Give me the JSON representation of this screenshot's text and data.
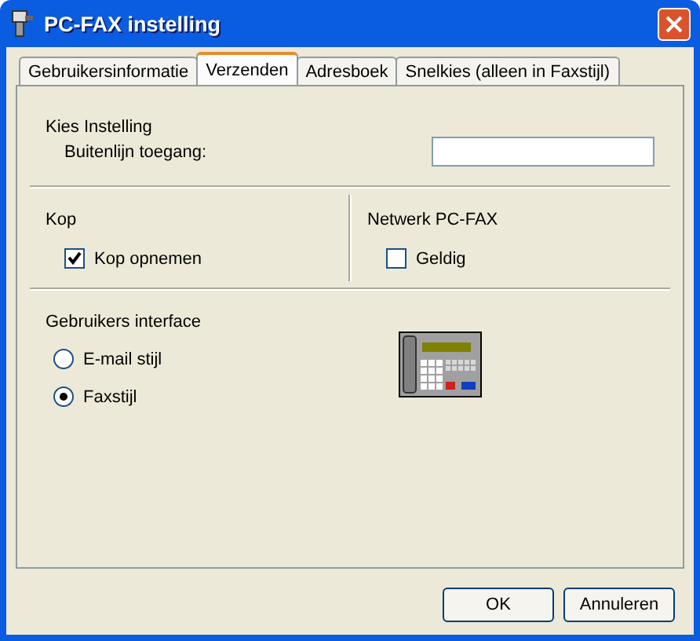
{
  "window": {
    "title": "PC-FAX instelling"
  },
  "tabs": [
    {
      "label": "Gebruikersinformatie",
      "selected": false
    },
    {
      "label": "Verzenden",
      "selected": true
    },
    {
      "label": "Adresboek",
      "selected": false
    },
    {
      "label": "Snelkies (alleen in Faxstijl)",
      "selected": false
    }
  ],
  "dial": {
    "heading": "Kies Instelling",
    "label": "Buitenlijn toegang:"
  },
  "header": {
    "heading": "Kop",
    "checkbox": {
      "label": "Kop opnemen",
      "checked": true
    }
  },
  "network": {
    "heading": "Netwerk PC-FAX",
    "checkbox": {
      "label": "Geldig",
      "checked": false
    }
  },
  "interface": {
    "heading": "Gebruikers interface",
    "options": [
      {
        "label": "E-mail stijl",
        "selected": false
      },
      {
        "label": "Faxstijl",
        "selected": true
      }
    ]
  },
  "buttons": [
    "OK",
    "Annuleren"
  ]
}
